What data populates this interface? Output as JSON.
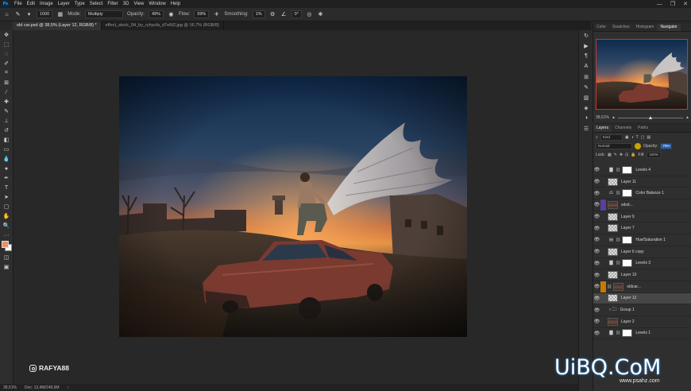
{
  "menubar": {
    "logo": "Ps",
    "items": [
      "File",
      "Edit",
      "Image",
      "Layer",
      "Type",
      "Select",
      "Filter",
      "3D",
      "View",
      "Window",
      "Help"
    ],
    "window_controls": [
      "—",
      "❐",
      "✕"
    ]
  },
  "options": {
    "brush_size": "1000",
    "mode_label": "Mode:",
    "mode_value": "Multiply",
    "opacity_label": "Opacity:",
    "opacity_value": "49%",
    "flow_label": "Flow:",
    "flow_value": "59%",
    "smoothing_label": "Smoothing:",
    "smoothing_value": "1%",
    "angle_value": "0°"
  },
  "tabs": [
    {
      "label": "old car.psd @ 38,5% (Layer 12, RGB/8) *"
    },
    {
      "label": "effect_stock_04_by_ryhyufa_d7e6t2.jpg @ 16,7% (RGB/8)"
    }
  ],
  "status": {
    "zoom": "38,61%",
    "doc": "Doc: 13,4M/248,9M"
  },
  "watermark": {
    "handle": "RAFYA88"
  },
  "navigator": {
    "tabs": [
      "Color",
      "Swatches",
      "Histogram",
      "Navigator"
    ],
    "active_tab": "Navigator",
    "zoom": "38,61%"
  },
  "layers_panel": {
    "tabs": [
      "Layers",
      "Channels",
      "Paths"
    ],
    "filter_label": "Kind",
    "blend_mode": "Normal",
    "opacity_label": "Opacity:",
    "opacity_value": "79%",
    "lock_label": "Lock:",
    "fill_label": "Fill:",
    "fill_value": "100%",
    "layers": [
      {
        "name": "Levels 4",
        "thumb": "white",
        "adj": "▇",
        "chain": true,
        "tag": ""
      },
      {
        "name": "Layer 11",
        "thumb": "checker",
        "adj": "",
        "chain": false,
        "tag": ""
      },
      {
        "name": "Color Balance 1",
        "thumb": "white",
        "adj": "⚖",
        "chain": true,
        "tag": ""
      },
      {
        "name": "sdsd...",
        "thumb": "image",
        "adj": "",
        "chain": false,
        "tag": "#5a3fa0"
      },
      {
        "name": "Layer 9",
        "thumb": "checker",
        "adj": "",
        "chain": false,
        "tag": ""
      },
      {
        "name": "Layer 7",
        "thumb": "checker",
        "adj": "",
        "chain": false,
        "tag": ""
      },
      {
        "name": "Hue/Saturation 1",
        "thumb": "white",
        "adj": "▤",
        "chain": true,
        "tag": ""
      },
      {
        "name": "Layer 6 copy",
        "thumb": "checker",
        "adj": "",
        "chain": false,
        "tag": ""
      },
      {
        "name": "Levels 3",
        "thumb": "white",
        "adj": "▇",
        "chain": true,
        "tag": ""
      },
      {
        "name": "Layer 10",
        "thumb": "checker",
        "adj": "",
        "chain": false,
        "tag": ""
      },
      {
        "name": "oldcar...",
        "thumb": "image",
        "adj": "",
        "chain": true,
        "tag": "#c87a00"
      },
      {
        "name": "Layer 12",
        "thumb": "checker",
        "adj": "",
        "chain": false,
        "tag": "",
        "selected": true
      },
      {
        "name": "Group 1",
        "thumb": "folder",
        "adj": "",
        "chain": false,
        "tag": ""
      },
      {
        "name": "Layer 2",
        "thumb": "image",
        "adj": "",
        "chain": false,
        "tag": ""
      },
      {
        "name": "Levels 1",
        "thumb": "white",
        "adj": "▇",
        "chain": true,
        "tag": ""
      }
    ]
  },
  "site_watermark": {
    "brand": "UiBQ.CoM",
    "url": "www.psahz.com"
  },
  "colors": {
    "foreground": "#e8906a",
    "background": "#ffffff",
    "selection_red": "#cc3333"
  }
}
